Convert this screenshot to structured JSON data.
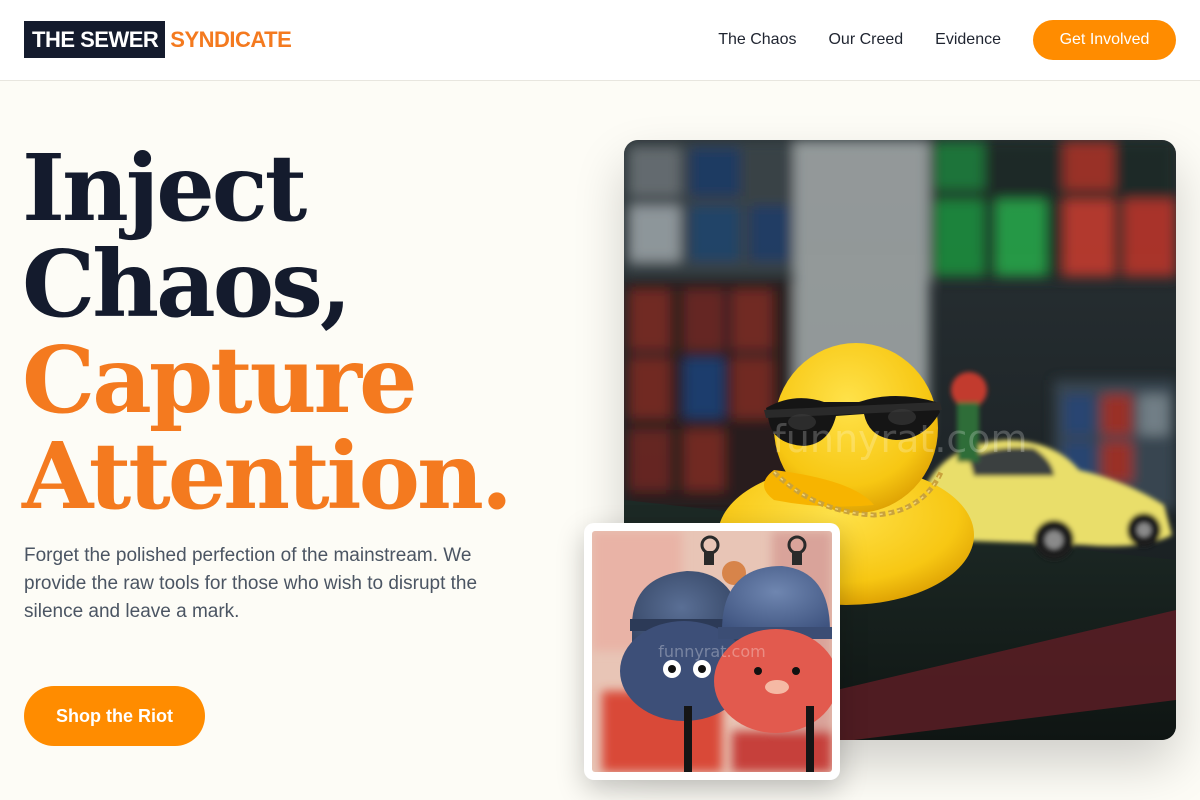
{
  "brand": {
    "logo_dark": "THE SEWER",
    "logo_accent": "SYNDICATE"
  },
  "nav": {
    "links": [
      "The Chaos",
      "Our Creed",
      "Evidence"
    ],
    "cta": "Get Involved"
  },
  "hero": {
    "headline_lines": [
      "Inject",
      "Chaos,",
      "Capture",
      "Attention."
    ],
    "lede": "Forget the polished perfection of the mainstream. We provide the raw tools for those who wish to disrupt the silence and leave a mark.",
    "cta": "Shop the Riot"
  },
  "images": {
    "main": {
      "subject": "yellow rubber duck with sunglasses and gold chain beside a toy car and rubik's cubes",
      "watermark": "funnyrat.com"
    },
    "secondary": {
      "subject": "two plush denim keychain toys, blue and red",
      "watermark": "funnyrat.com"
    }
  },
  "colors": {
    "accent": "#ff8c00",
    "accent_text": "#f47a1f",
    "dark": "#141b2d",
    "background": "#fdfcf6"
  }
}
